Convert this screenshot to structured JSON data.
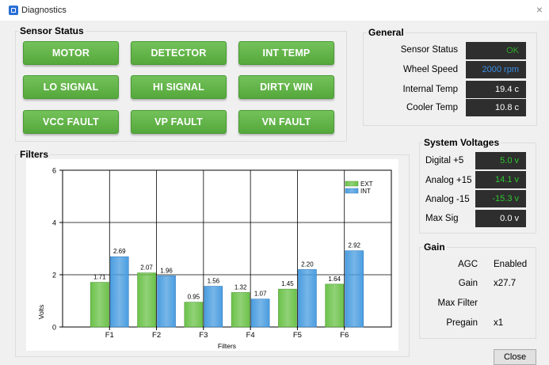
{
  "window": {
    "title": "Diagnostics",
    "close_glyph": "×"
  },
  "sensor_status": {
    "title": "Sensor Status",
    "buttons": [
      "MOTOR",
      "DETECTOR",
      "INT TEMP",
      "LO SIGNAL",
      "HI SIGNAL",
      "DIRTY WIN",
      "VCC FAULT",
      "VP FAULT",
      "VN FAULT"
    ]
  },
  "general": {
    "title": "General",
    "rows": [
      {
        "label": "Sensor Status",
        "value": "OK",
        "color": "#2fa82f"
      },
      {
        "label": "Wheel Speed",
        "value": "2000 rpm",
        "color": "#3a8ee6"
      },
      {
        "label": "Internal Temp",
        "value": "19.4 c",
        "color": "#ffffff"
      },
      {
        "label": "Cooler Temp",
        "value": "10.8 c",
        "color": "#ffffff"
      }
    ]
  },
  "system_voltages": {
    "title": "System Voltages",
    "rows": [
      {
        "label": "Digital +5",
        "value": "5.0 v",
        "color": "#2fc82f"
      },
      {
        "label": "Analog +15",
        "value": "14.1 v",
        "color": "#2fc82f"
      },
      {
        "label": "Analog -15",
        "value": "-15.3 v",
        "color": "#2fc82f"
      },
      {
        "label": "Max Sig",
        "value": "0.0 v",
        "color": "#ffffff"
      }
    ]
  },
  "gain": {
    "title": "Gain",
    "rows": [
      {
        "label": "AGC",
        "value": "Enabled"
      },
      {
        "label": "Gain",
        "value": "x27.7"
      },
      {
        "label": "Max Filter",
        "value": ""
      },
      {
        "label": "Pregain",
        "value": "x1"
      }
    ]
  },
  "filters": {
    "title": "Filters"
  },
  "close_button": {
    "label": "Close"
  },
  "chart_data": {
    "type": "bar",
    "categories": [
      "F1",
      "F2",
      "F3",
      "F4",
      "F5",
      "F6"
    ],
    "series": [
      {
        "name": "EXT",
        "values": [
          1.71,
          2.07,
          0.95,
          1.32,
          1.45,
          1.64
        ],
        "color": "#6cc24a"
      },
      {
        "name": "INT",
        "values": [
          2.69,
          1.96,
          1.56,
          1.07,
          2.2,
          2.92
        ],
        "color": "#4a9de0"
      }
    ],
    "value_labels": [
      [
        "1.71",
        "2.07",
        "0.95",
        "1.32",
        "1.45",
        "1.64"
      ],
      [
        "2.69",
        "1.96",
        "1.56",
        "1.07",
        "2.20",
        "2.92"
      ]
    ],
    "xlabel": "Filters",
    "ylabel": "Volts",
    "ylim": [
      0,
      6
    ],
    "yticks": [
      0,
      2,
      4,
      6
    ],
    "grid": true,
    "legend": "top-right"
  }
}
